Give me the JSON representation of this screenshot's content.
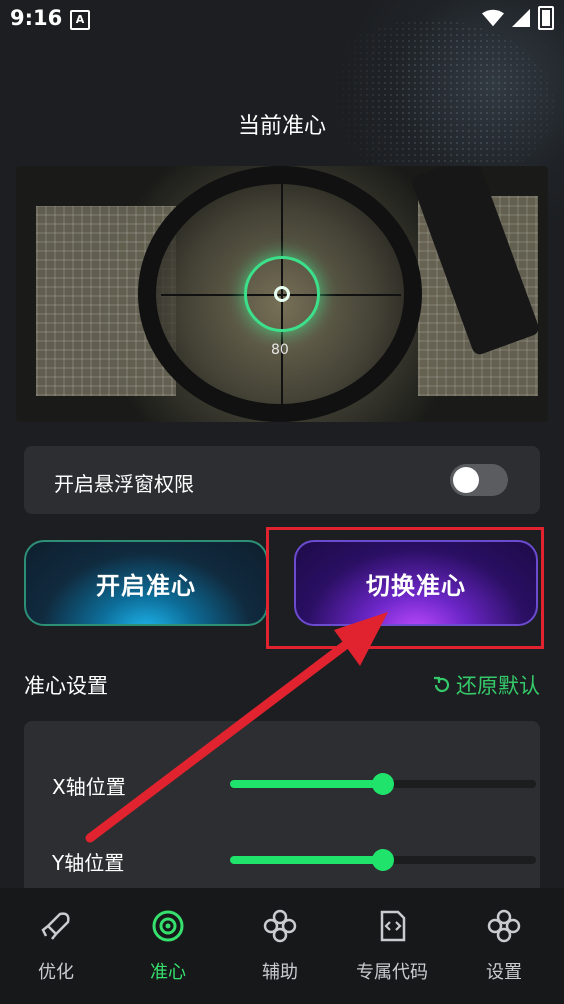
{
  "status_bar": {
    "time": "9:16",
    "notif_icon": "A"
  },
  "header": {
    "title": "当前准心"
  },
  "preview": {
    "hud_value": "80"
  },
  "overlay_permission": {
    "label": "开启悬浮窗权限",
    "enabled": false
  },
  "actions": {
    "open_label": "开启准心",
    "switch_label": "切换准心"
  },
  "settings": {
    "title": "准心设置",
    "reset_label": "还原默认",
    "sliders": [
      {
        "label": "X轴位置",
        "value": 0.5
      },
      {
        "label": "Y轴位置",
        "value": 0.5
      }
    ]
  },
  "nav": {
    "items": [
      {
        "label": "优化",
        "icon": "rocket-icon"
      },
      {
        "label": "准心",
        "icon": "crosshair-icon",
        "active": true
      },
      {
        "label": "辅助",
        "icon": "clover-icon"
      },
      {
        "label": "专属代码",
        "icon": "code-file-icon"
      },
      {
        "label": "设置",
        "icon": "clover-settings-icon"
      }
    ]
  },
  "colors": {
    "accent": "#35e06d",
    "annotation": "#e0232e",
    "card": "#2c2e31",
    "background": "#1c1e21"
  }
}
